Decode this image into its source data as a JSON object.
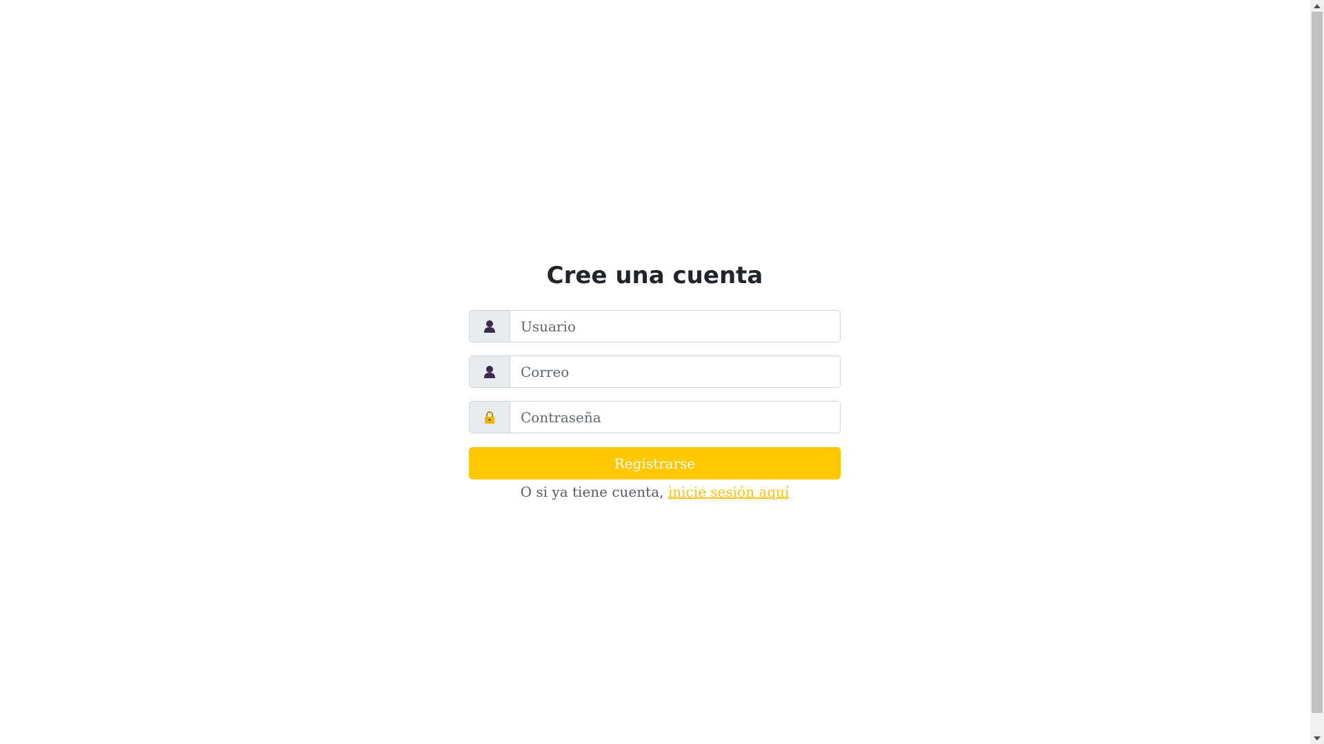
{
  "form": {
    "title": "Cree una cuenta",
    "username": {
      "placeholder": "Usuario",
      "value": "",
      "icon": "user-icon"
    },
    "email": {
      "placeholder": "Correo",
      "value": "",
      "icon": "user-icon"
    },
    "password": {
      "placeholder": "Contraseña",
      "value": "",
      "icon": "lock-icon"
    },
    "submit_label": "Registrarse",
    "login_prompt": "O si ya tiene cuenta,",
    "login_link": "inicie sesión aquí"
  },
  "colors": {
    "accent": "#ffc800",
    "link": "#ffc107",
    "user_icon": "#3d2b4f",
    "lock_icon": "#f0b400",
    "addon_bg": "#e9ecef",
    "border": "#ced4da"
  }
}
